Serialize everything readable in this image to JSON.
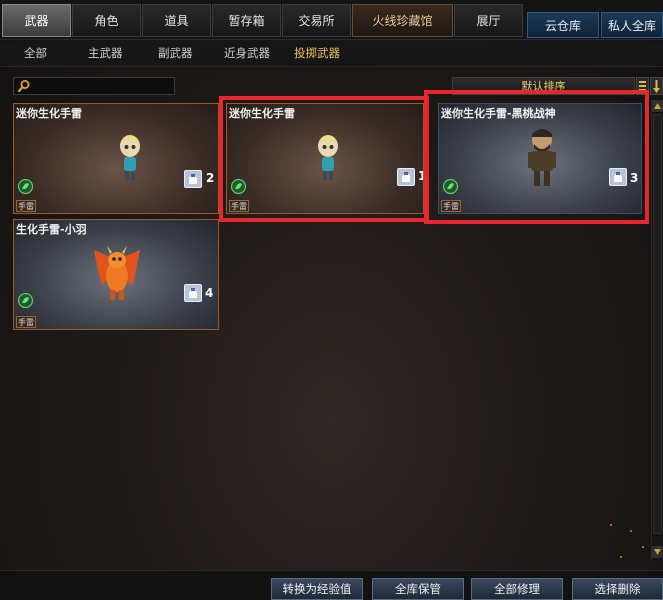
{
  "top_tabs": [
    "武器",
    "角色",
    "道具",
    "暂存箱",
    "交易所",
    "火线珍藏馆",
    "展厅"
  ],
  "storage_tabs": [
    "云仓库",
    "私人全库"
  ],
  "sub_tabs": [
    "全部",
    "主武器",
    "副武器",
    "近身武器",
    "投掷武器"
  ],
  "active_sub_tab": "投掷武器",
  "search": {
    "value": "",
    "placeholder": ""
  },
  "sort_label": "默认排序",
  "cards": [
    {
      "name": "迷你生化手雷",
      "count": "2",
      "tag": "手雷",
      "selected": false
    },
    {
      "name": "迷你生化手雷",
      "count": "1",
      "tag": "手雷",
      "selected": true
    },
    {
      "name": "迷你生化手雷-黑桃战神",
      "count": "3",
      "tag": "手雷",
      "selected": true
    },
    {
      "name": "生化手雷-小羽",
      "count": "4",
      "tag": "手雷",
      "selected": false
    }
  ],
  "bottom_buttons": [
    "转换为经验值",
    "全库保管",
    "全部修理",
    "选择删除"
  ],
  "colors": {
    "highlight": "#e8262e",
    "card_border": "#9a5a2a",
    "active_sub_tab": "#f0c15a"
  }
}
